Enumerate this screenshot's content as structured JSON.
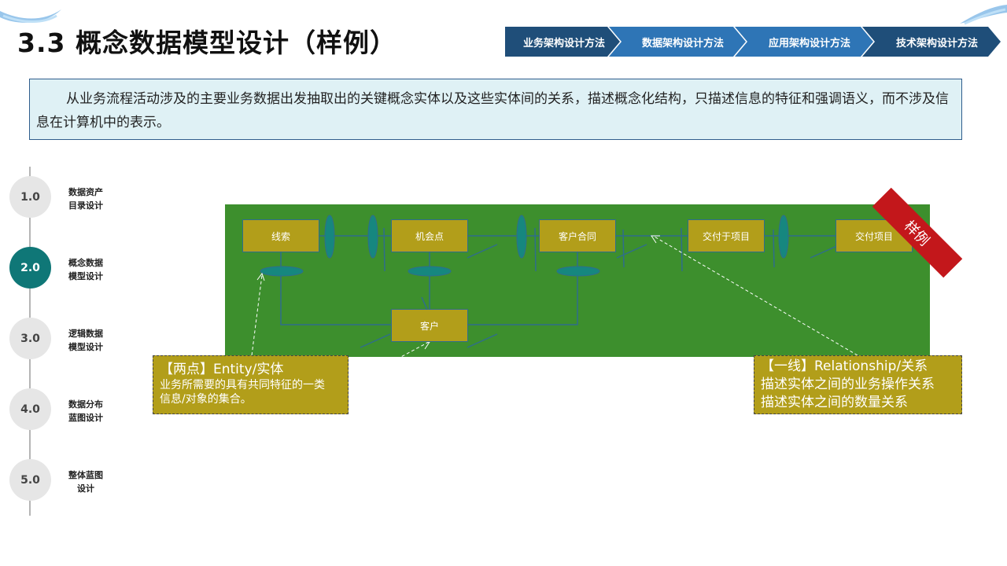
{
  "header": {
    "title": "3.3 概念数据模型设计（样例）"
  },
  "nav_steps": [
    {
      "label": "业务架构设计方法",
      "color": "#1f4e79"
    },
    {
      "label": "数据架构设计方法",
      "color": "#2e75b6"
    },
    {
      "label": "应用架构设计方法",
      "color": "#2e75b6"
    },
    {
      "label": "技术架构设计方法",
      "color": "#1f4e79"
    }
  ],
  "description": "从业务流程活动涉及的主要业务数据出发抽取出的关键概念实体以及这些实体间的关系，描述概念化结构，只描述信息的特征和强调语义，而不涉及信息在计算机中的表示。",
  "steps": [
    {
      "number": "1.0",
      "label_line1": "数据资产",
      "label_line2": "目录设计",
      "active": false
    },
    {
      "number": "2.0",
      "label_line1": "概念数据",
      "label_line2": "模型设计",
      "active": true
    },
    {
      "number": "3.0",
      "label_line1": "逻辑数据",
      "label_line2": "模型设计",
      "active": false
    },
    {
      "number": "4.0",
      "label_line1": "数据分布",
      "label_line2": "蓝图设计",
      "active": false
    },
    {
      "number": "5.0",
      "label_line1": "整体蓝图",
      "label_line2": "设计",
      "active": false
    }
  ],
  "diagram": {
    "entities": [
      "线索",
      "机会点",
      "客户合同",
      "交付于项目",
      "交付项目",
      "客户"
    ],
    "sample_label": "样例",
    "colors": {
      "panel": "#3d8f2d",
      "entity": "#b29e1a",
      "connector": "#16877f",
      "ribbon": "#c3171b"
    }
  },
  "callouts": {
    "entity_title": "【两点】Entity/实体",
    "entity_desc_1": "业务所需要的具有共同特征的一类",
    "entity_desc_2": "信息/对象的集合。",
    "relationship_title": "【一线】Relationship/关系",
    "relationship_line_1": "描述实体之间的业务操作关系",
    "relationship_line_2": "描述实体之间的数量关系"
  }
}
